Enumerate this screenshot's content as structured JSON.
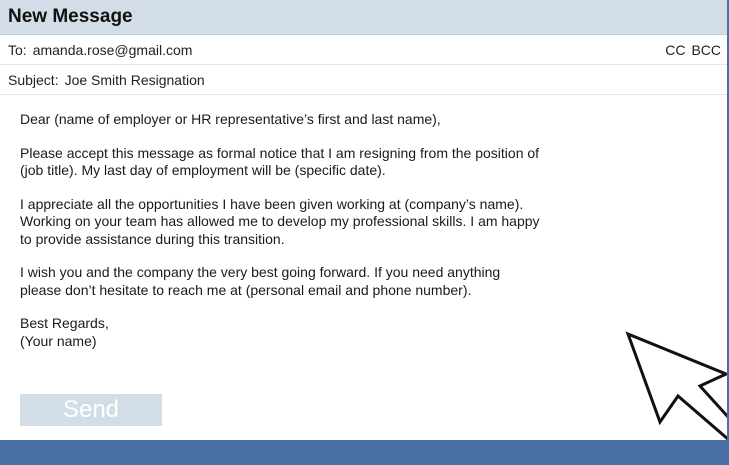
{
  "window": {
    "title": "New Message"
  },
  "header": {
    "to_label": "To:",
    "to_value": "amanda.rose@gmail.com",
    "cc_label": "CC",
    "bcc_label": "BCC",
    "subject_label": "Subject:",
    "subject_value": "Joe Smith Resignation"
  },
  "body": {
    "greeting": "Dear (name of employer or HR representative’s first and last name),",
    "paragraph1": "Please accept this message as formal notice that I am resigning from the position of\n(job title).  My last day of employment will be (specific date).",
    "paragraph2": "I appreciate all the opportunities I have been given working at (company’s name).\nWorking on your team has allowed me to develop my professional skills.  I am happy\nto provide assistance during this transition.",
    "paragraph3": "I wish you and the company the very best going forward. If you need anything\nplease don’t hesitate to reach me at (personal email and phone number).",
    "signoff": "Best Regards,\n(Your name)"
  },
  "actions": {
    "send_label": "Send"
  },
  "icons": {
    "cursor": "mouse-pointer-icon"
  },
  "colors": {
    "title_bar": "#d3dde8",
    "frame_border": "#4a6fa5",
    "send_button": "#d3dde8"
  }
}
